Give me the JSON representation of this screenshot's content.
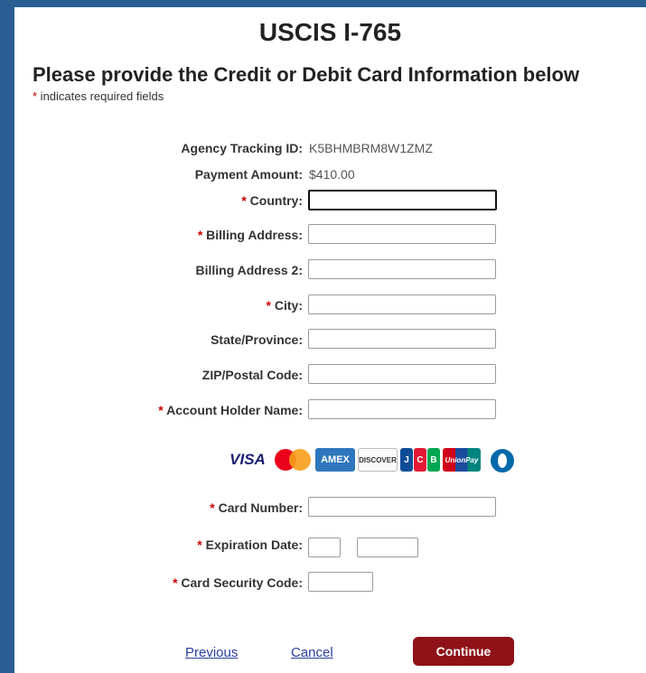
{
  "page": {
    "title": "USCIS I-765",
    "subtitle": "Please provide the Credit or Debit Card Information below",
    "required_note_star": "*",
    "required_note": " indicates required fields"
  },
  "info": {
    "tracking_label": "Agency Tracking ID:",
    "tracking_value": "K5BHMBRM8W1ZMZ",
    "amount_label": "Payment Amount:",
    "amount_value": "$410.00"
  },
  "fields": {
    "country": {
      "label": "Country:",
      "required": true,
      "value": ""
    },
    "billing_address": {
      "label": "Billing Address:",
      "required": true,
      "value": ""
    },
    "billing_address_2": {
      "label": "Billing Address 2:",
      "required": false,
      "value": ""
    },
    "city": {
      "label": "City:",
      "required": true,
      "value": ""
    },
    "state": {
      "label": "State/Province:",
      "required": false,
      "value": ""
    },
    "zip": {
      "label": "ZIP/Postal Code:",
      "required": false,
      "value": ""
    },
    "holder": {
      "label": "Account Holder Name:",
      "required": true,
      "value": ""
    },
    "card_number": {
      "label": "Card Number:",
      "required": true,
      "value": ""
    },
    "expiration": {
      "label": "Expiration Date:",
      "required": true,
      "month": "",
      "year": ""
    },
    "security": {
      "label": "Card Security Code:",
      "required": true,
      "value": ""
    }
  },
  "card_logos": {
    "visa": "VISA",
    "amex": "AMEX",
    "discover": "DISCOVER",
    "unionpay": "UnionPay",
    "jcb": [
      "J",
      "C",
      "B"
    ]
  },
  "actions": {
    "previous": "Previous",
    "cancel": "Cancel",
    "continue": "Continue"
  },
  "colors": {
    "frame": "#2b5f93",
    "continue_button": "#8e1218",
    "required_star": "#cc0000",
    "link": "#2a3f9d"
  }
}
